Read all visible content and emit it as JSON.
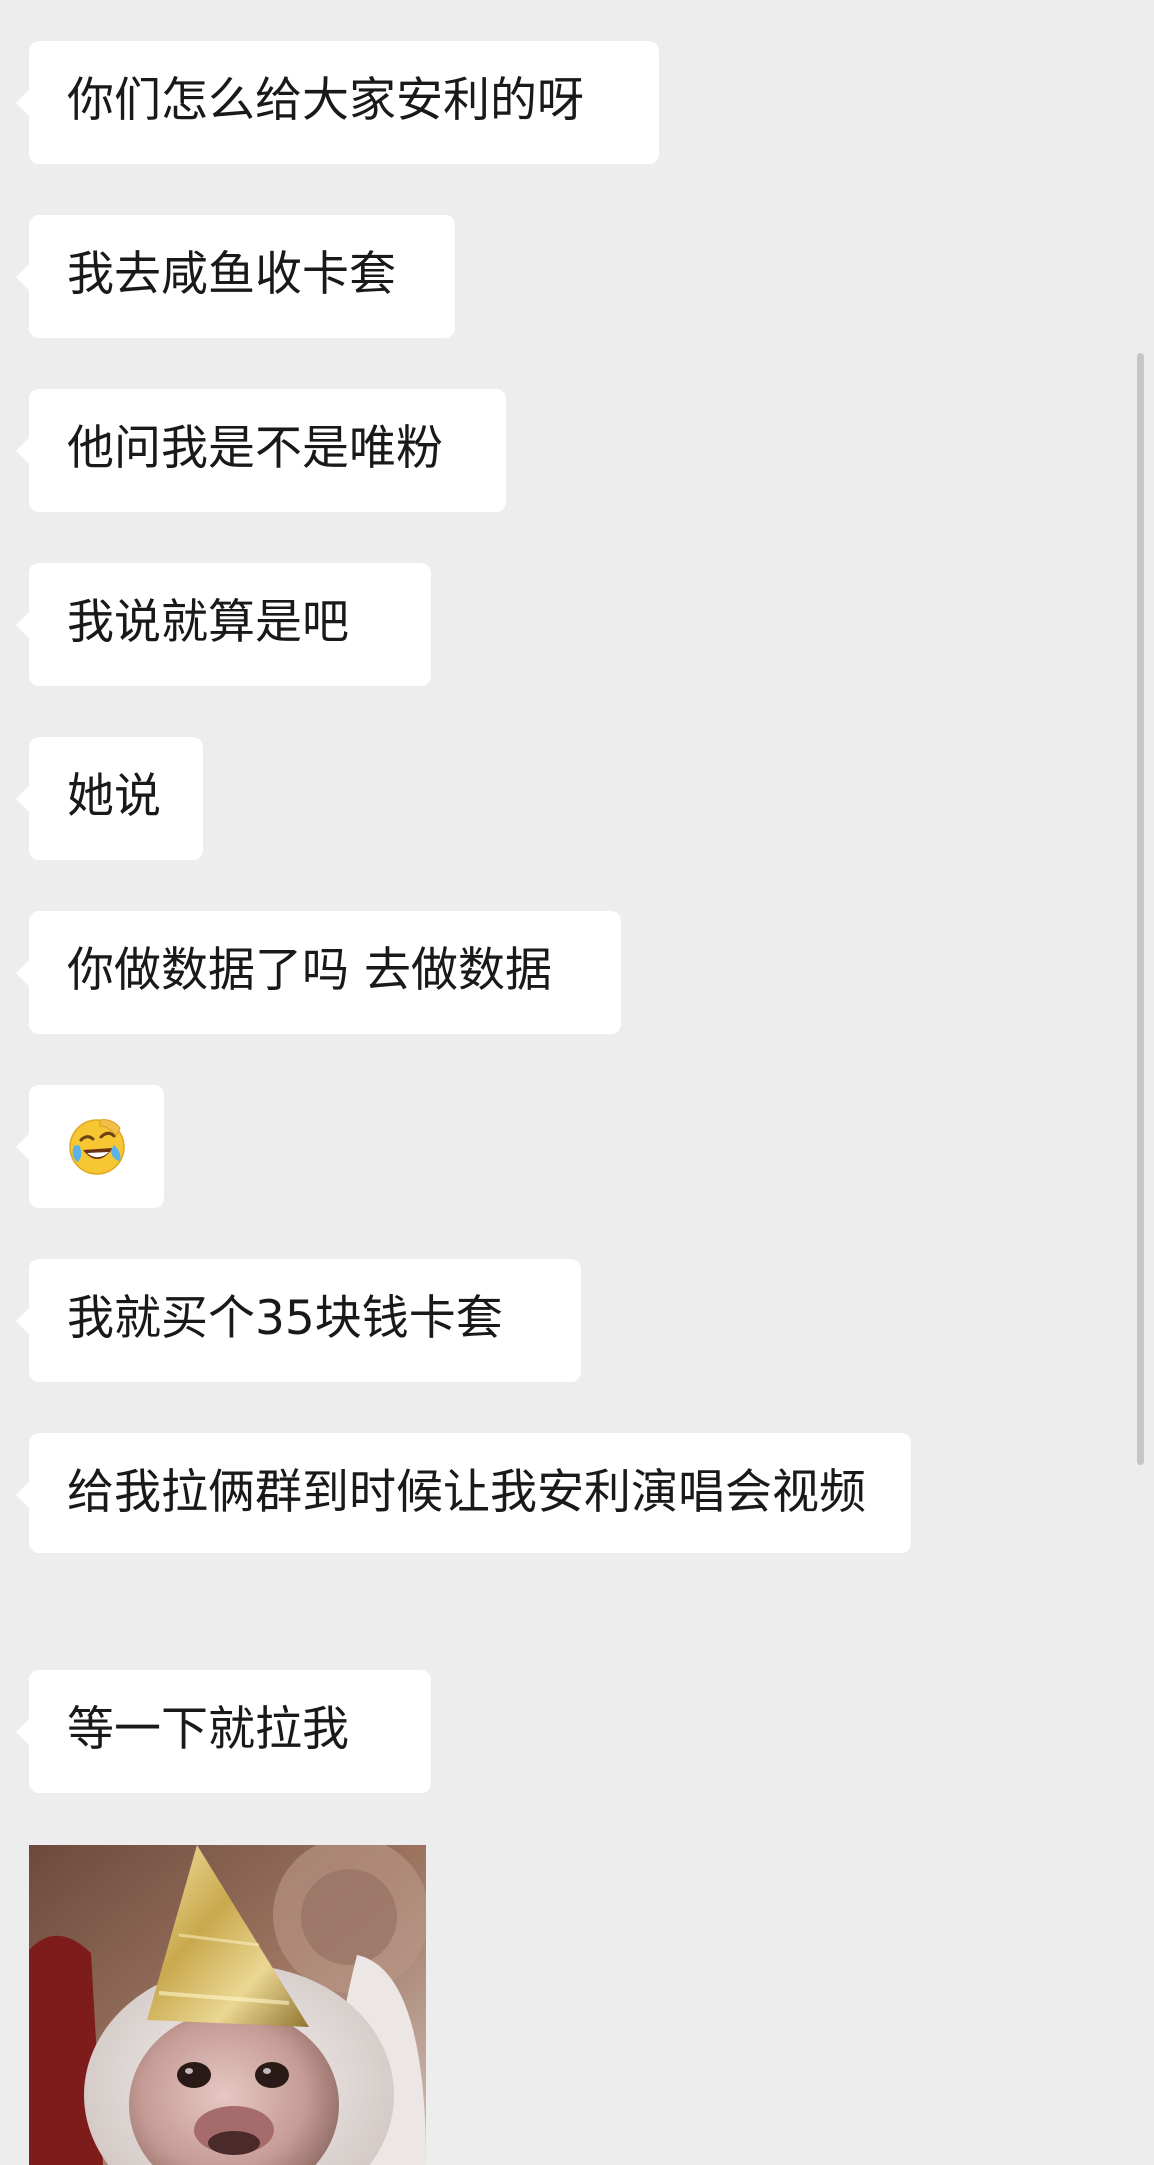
{
  "messages": [
    {
      "text": "你们怎么给大家安利的呀"
    },
    {
      "text": "我去咸鱼收卡套"
    },
    {
      "text": "他问我是不是唯粉"
    },
    {
      "text": "我说就算是吧"
    },
    {
      "text": "她说"
    },
    {
      "text": "你做数据了吗 去做数据"
    },
    {
      "emoji": "face-with-tears-of-joy"
    },
    {
      "text": "我就买个35块钱卡套"
    },
    {
      "text": "给我拉俩群到时候让我安利演唱会视频"
    },
    {
      "text": "等一下就拉我"
    },
    {
      "sticker": "monkey-with-party-hat"
    }
  ],
  "colors": {
    "background": "#ededed",
    "bubble": "#ffffff",
    "text": "#191919",
    "scrollbar": "#c6c6c6"
  }
}
